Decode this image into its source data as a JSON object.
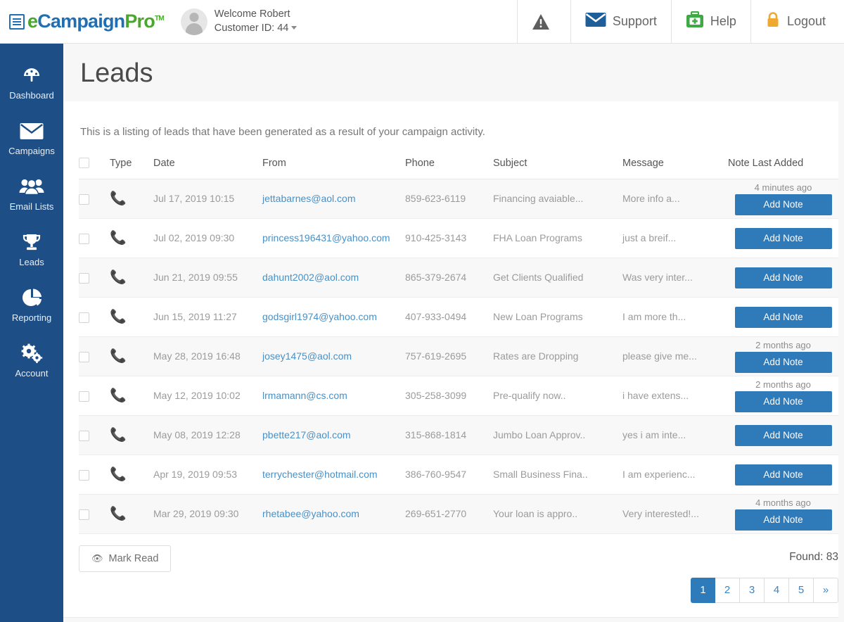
{
  "header": {
    "logo": {
      "e": "e",
      "campaign": "Campaign",
      "pro": "Pro",
      "tm": "TM",
      "icon": "document-icon"
    },
    "welcome_line": "Welcome Robert",
    "customer_line": "Customer ID: 44",
    "nav": [
      {
        "key": "alerts",
        "label": "",
        "icon": "warning-triangle-icon"
      },
      {
        "key": "support",
        "label": "Support",
        "icon": "envelope-icon"
      },
      {
        "key": "help",
        "label": "Help",
        "icon": "first-aid-kit-icon"
      },
      {
        "key": "logout",
        "label": "Logout",
        "icon": "lock-icon"
      }
    ]
  },
  "sidebar": {
    "items": [
      {
        "label": "Dashboard",
        "icon": "gauge-icon"
      },
      {
        "label": "Campaigns",
        "icon": "envelope-icon"
      },
      {
        "label": "Email Lists",
        "icon": "users-icon"
      },
      {
        "label": "Leads",
        "icon": "trophy-icon"
      },
      {
        "label": "Reporting",
        "icon": "pie-chart-icon"
      },
      {
        "label": "Account",
        "icon": "gears-icon"
      }
    ]
  },
  "page": {
    "title": "Leads",
    "intro": "This is a listing of leads that have been generated as a result of your campaign activity."
  },
  "table": {
    "columns": [
      "Type",
      "Date",
      "From",
      "Phone",
      "Subject",
      "Message",
      "Note Last Added"
    ],
    "rows": [
      {
        "type_icon": "phone-icon",
        "date": "Jul 17, 2019 10:15",
        "from": "jettabarnes@aol.com",
        "phone": "859-623-6119",
        "subject": "Financing avaiable...",
        "message": "More info a...",
        "note_ago": "4 minutes ago",
        "note_button": "Add Note"
      },
      {
        "type_icon": "phone-icon",
        "date": "Jul 02, 2019 09:30",
        "from": "princess196431@yahoo.com",
        "phone": "910-425-3143",
        "subject": "FHA Loan Programs",
        "message": "just a breif...",
        "note_ago": "",
        "note_button": "Add Note"
      },
      {
        "type_icon": "phone-icon",
        "date": "Jun 21, 2019 09:55",
        "from": "dahunt2002@aol.com",
        "phone": "865-379-2674",
        "subject": "Get Clients Qualified",
        "message": "Was very inter...",
        "note_ago": "",
        "note_button": "Add Note"
      },
      {
        "type_icon": "phone-icon",
        "date": "Jun 15, 2019 11:27",
        "from": "godsgirl1974@yahoo.com",
        "phone": "407-933-0494",
        "subject": "New Loan Programs",
        "message": "I am more th...",
        "note_ago": "",
        "note_button": "Add Note"
      },
      {
        "type_icon": "phone-icon",
        "date": "May 28, 2019 16:48",
        "from": "josey1475@aol.com",
        "phone": "757-619-2695",
        "subject": "Rates are Dropping",
        "message": "please give me...",
        "note_ago": "2 months ago",
        "note_button": "Add Note"
      },
      {
        "type_icon": "phone-icon",
        "date": "May 12, 2019 10:02",
        "from": "lrmamann@cs.com",
        "phone": "305-258-3099",
        "subject": "Pre-qualify now..",
        "message": "i have extens...",
        "note_ago": "2 months ago",
        "note_button": "Add Note"
      },
      {
        "type_icon": "phone-icon",
        "date": "May 08, 2019 12:28",
        "from": "pbette217@aol.com",
        "phone": "315-868-1814",
        "subject": "Jumbo Loan Approv..",
        "message": "yes i am inte...",
        "note_ago": "",
        "note_button": "Add Note"
      },
      {
        "type_icon": "phone-icon",
        "date": "Apr 19, 2019 09:53",
        "from": "terrychester@hotmail.com",
        "phone": "386-760-9547",
        "subject": "Small Business Fina..",
        "message": "I am experienc...",
        "note_ago": "",
        "note_button": "Add Note"
      },
      {
        "type_icon": "phone-icon",
        "date": "Mar 29, 2019 09:30",
        "from": "rhetabee@yahoo.com",
        "phone": "269-651-2770",
        "subject": "Your loan is appro..",
        "message": "Very interested!...",
        "note_ago": "4 months ago",
        "note_button": "Add Note"
      }
    ]
  },
  "footer": {
    "mark_read_label": "Mark Read",
    "mark_read_icon": "eye-icon",
    "found_label": "Found: 83",
    "pagination": [
      "1",
      "2",
      "3",
      "4",
      "5",
      "»"
    ],
    "pagination_active_index": 0
  },
  "colors": {
    "sidebar_bg": "#1d4e85",
    "accent_blue": "#2f7ab8",
    "link_blue": "#4a90c4",
    "logo_green": "#4aa72e",
    "logo_blue": "#1f6fb2",
    "row_stripe": "#f8f8f8"
  }
}
